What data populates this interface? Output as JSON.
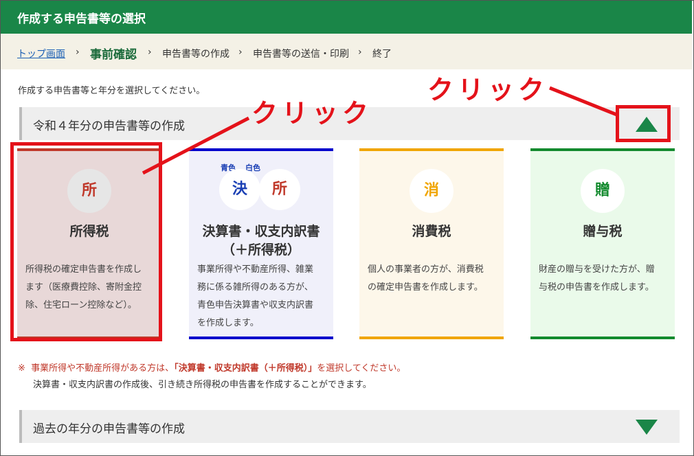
{
  "header": {
    "title": "作成する申告書等の選択"
  },
  "breadcrumb": {
    "home": "トップ画面",
    "sep": "›",
    "current": "事前確認",
    "step3": "申告書等の作成",
    "step4": "申告書等の送信・印刷",
    "step5": "終了"
  },
  "lead": "作成する申告書等と年分を選択してください。",
  "section_current": {
    "label": "令和４年分の申告書等の作成"
  },
  "cards": [
    {
      "icon": "所",
      "name": "所得税",
      "color": "#c0392b",
      "desc": [
        "所得税の確定申告書を作成し",
        "ます（医療費控除、寄附金控",
        "除、住宅ローン控除など）。"
      ]
    },
    {
      "icon_a": "決",
      "icon_b": "所",
      "mini_a": "青色",
      "mini_b": "白色",
      "name_line1": "決算書・収支内訳書",
      "name_line2": "（＋所得税）",
      "desc": [
        "事業所得や不動産所得、雑業",
        "務に係る雑所得のある方が、",
        "青色申告決算書や収支内訳書",
        "を作成します。"
      ]
    },
    {
      "icon": "消",
      "name": "消費税",
      "color": "#f0a500",
      "desc": [
        "個人の事業者の方が、消費税",
        "の確定申告書を作成します。"
      ]
    },
    {
      "icon": "贈",
      "name": "贈与税",
      "color": "#138a2e",
      "desc": [
        "財産の贈与を受けた方が、贈",
        "与税の申告書を作成します。"
      ]
    }
  ],
  "note": {
    "mark": "※",
    "line1_a": "事業所得や不動産所得がある方は、",
    "line1_b": "「決算書・収支内訳書（＋所得税）」",
    "line1_c": "を選択してください。",
    "line2": "決算書・収支内訳書の作成後、引き続き所得税の申告書を作成することができます。"
  },
  "section_past": {
    "label": "過去の年分の申告書等の作成"
  },
  "annotations": {
    "click1": "クリック",
    "click2": "クリック",
    "color": "#e4121a"
  },
  "colors": {
    "brand_green": "#1a8648"
  }
}
